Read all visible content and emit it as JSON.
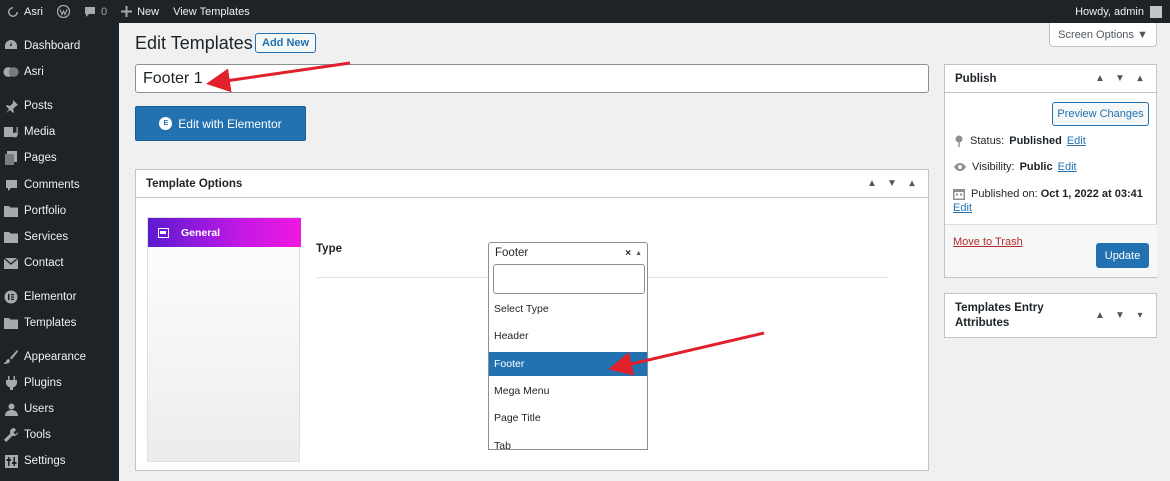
{
  "adminbar": {
    "site_name": "Asri",
    "comments_count": "0",
    "new_label": "New",
    "view_label": "View Templates",
    "howdy": "Howdy, admin"
  },
  "sidebar": {
    "items": [
      {
        "label": "Dashboard",
        "icon": "dashboard-icon"
      },
      {
        "label": "Asri",
        "icon": "asri-icon"
      },
      {
        "label": "Posts",
        "icon": "pin-icon"
      },
      {
        "label": "Media",
        "icon": "media-icon"
      },
      {
        "label": "Pages",
        "icon": "pages-icon"
      },
      {
        "label": "Comments",
        "icon": "comment-icon"
      },
      {
        "label": "Portfolio",
        "icon": "folder-icon"
      },
      {
        "label": "Services",
        "icon": "folder-icon"
      },
      {
        "label": "Contact",
        "icon": "mail-icon"
      },
      {
        "label": "Elementor",
        "icon": "elementor-icon"
      },
      {
        "label": "Templates",
        "icon": "folder-icon"
      },
      {
        "label": "Appearance",
        "icon": "brush-icon"
      },
      {
        "label": "Plugins",
        "icon": "plugin-icon"
      },
      {
        "label": "Users",
        "icon": "user-icon"
      },
      {
        "label": "Tools",
        "icon": "wrench-icon"
      },
      {
        "label": "Settings",
        "icon": "settings-icon"
      }
    ]
  },
  "header": {
    "title": "Edit Templates",
    "add_new": "Add New",
    "screen_options": "Screen Options ▼"
  },
  "post_title": "Footer 1",
  "elementor_button": "Edit with Elementor",
  "template_options": {
    "title": "Template Options",
    "tab_general": "General",
    "type_label": "Type",
    "selected_value": "Footer",
    "options": [
      "Select Type",
      "Header",
      "Footer",
      "Mega Menu",
      "Page Title",
      "Tab"
    ],
    "selected_index": 2
  },
  "publish": {
    "title": "Publish",
    "preview": "Preview Changes",
    "status_label": "Status:",
    "status_value": "Published",
    "visibility_label": "Visibility:",
    "visibility_value": "Public",
    "published_label": "Published on:",
    "published_value": "Oct 1, 2022 at 03:41",
    "edit": "Edit",
    "trash": "Move to Trash",
    "update": "Update"
  },
  "attributes": {
    "title": "Templates Entry Attributes"
  },
  "colors": {
    "accent": "#2271b1",
    "admin_dark": "#1d2327",
    "annotation_arrow": "#e0202a",
    "tab_gradient_start": "#5b1bd1",
    "tab_gradient_end": "#f018e0"
  }
}
